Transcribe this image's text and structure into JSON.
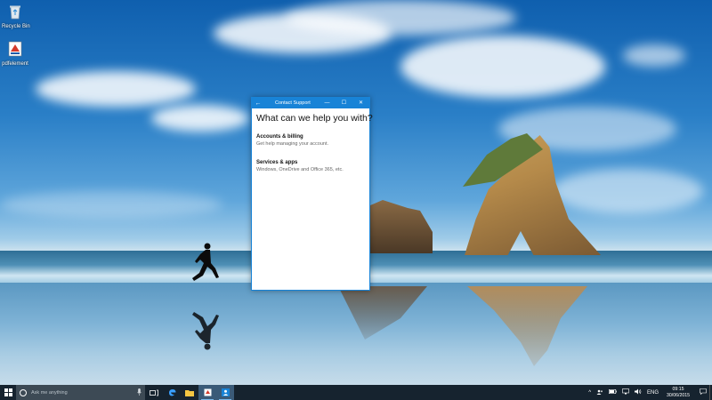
{
  "desktop": {
    "icons": [
      {
        "label": "Recycle Bin",
        "icon": "recycle-bin-icon"
      },
      {
        "label": "pdfelement",
        "icon": "app-shortcut-icon"
      }
    ]
  },
  "window": {
    "title": "Contact Support",
    "back_glyph": "←",
    "minimize_glyph": "—",
    "maximize_glyph": "☐",
    "close_glyph": "✕",
    "heading": "What can we help you with?",
    "options": [
      {
        "title": "Accounts & billing",
        "description": "Get help managing your account."
      },
      {
        "title": "Services & apps",
        "description": "Windows, OneDrive and Office 365, etc."
      }
    ],
    "accent": "#1883d7"
  },
  "taskbar": {
    "search_placeholder": "Ask me anything",
    "mic_glyph": "🎙",
    "language": "ENG",
    "time": "09:15",
    "date": "30/06/2015",
    "background": "#16232f"
  }
}
